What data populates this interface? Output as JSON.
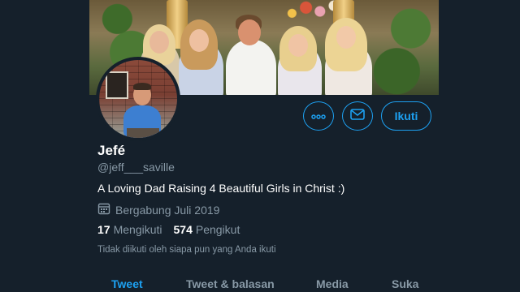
{
  "profile": {
    "name": "Jefé",
    "handle": "@jeff___saville",
    "bio": "A Loving Dad Raising 4 Beautiful Girls in Christ :)",
    "joined": "Bergabung Juli 2019",
    "following_count": "17",
    "following_label": "Mengikuti",
    "followers_count": "574",
    "followers_label": "Pengikut",
    "followers_note": "Tidak diikuti oleh siapa pun yang Anda ikuti"
  },
  "actions": {
    "more_icon": "more-icon",
    "message_icon": "mail-icon",
    "follow_label": "Ikuti"
  },
  "tabs": [
    {
      "label": "Tweet"
    },
    {
      "label": "Tweet & balasan"
    },
    {
      "label": "Media"
    },
    {
      "label": "Suka"
    }
  ],
  "colors": {
    "background": "#15202b",
    "accent": "#1da1f2",
    "secondary_text": "#8899a6"
  }
}
